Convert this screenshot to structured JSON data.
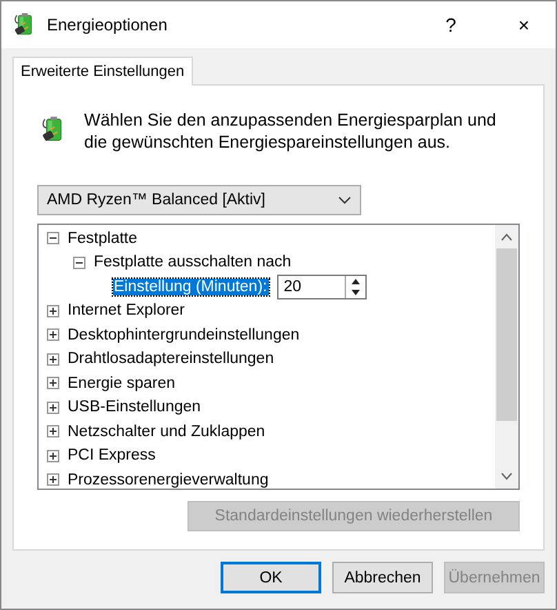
{
  "window": {
    "title": "Energieoptionen",
    "help": "?",
    "close": "×"
  },
  "tabs": [
    {
      "label": "Erweiterte Einstellungen",
      "selected": true
    }
  ],
  "description": "Wählen Sie den anzupassenden Energiesparplan und die gewünschten Energiespareinstellungen aus.",
  "plan": {
    "value": "AMD Ryzen™ Balanced [Aktiv]"
  },
  "tree": [
    {
      "label": "Festplatte",
      "expanded": true,
      "children": [
        {
          "label": "Festplatte ausschalten nach",
          "expanded": true,
          "children": [
            {
              "kind": "setting",
              "label": "Einstellung (Minuten):",
              "value": "20",
              "selected": true
            }
          ]
        }
      ]
    },
    {
      "label": "Internet Explorer",
      "expanded": false
    },
    {
      "label": "Desktophintergrundeinstellungen",
      "expanded": false
    },
    {
      "label": "Drahtlosadaptereinstellungen",
      "expanded": false
    },
    {
      "label": "Energie sparen",
      "expanded": false
    },
    {
      "label": "USB-Einstellungen",
      "expanded": false
    },
    {
      "label": "Netzschalter und Zuklappen",
      "expanded": false
    },
    {
      "label": "PCI Express",
      "expanded": false
    },
    {
      "label": "Prozessorenergieverwaltung",
      "expanded": false
    }
  ],
  "restore_button": {
    "label": "Standardeinstellungen wiederherstellen",
    "disabled": true
  },
  "buttons": [
    {
      "label": "OK",
      "disabled": false,
      "default": true
    },
    {
      "label": "Abbrechen",
      "disabled": false,
      "default": false
    },
    {
      "label": "Übernehmen",
      "disabled": true,
      "default": false
    }
  ]
}
